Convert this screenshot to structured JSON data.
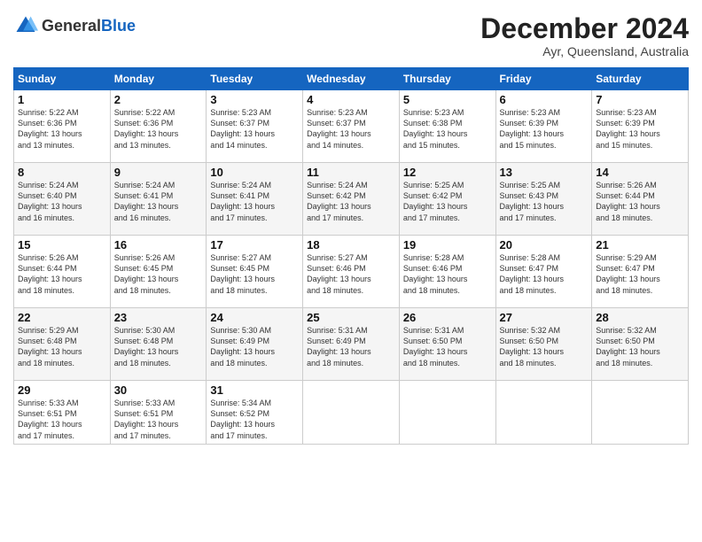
{
  "header": {
    "logo_general": "General",
    "logo_blue": "Blue",
    "month_title": "December 2024",
    "subtitle": "Ayr, Queensland, Australia"
  },
  "days_of_week": [
    "Sunday",
    "Monday",
    "Tuesday",
    "Wednesday",
    "Thursday",
    "Friday",
    "Saturday"
  ],
  "weeks": [
    [
      {
        "day": "1",
        "sunrise": "5:22 AM",
        "sunset": "6:36 PM",
        "daylight": "13 hours and 13 minutes."
      },
      {
        "day": "2",
        "sunrise": "5:22 AM",
        "sunset": "6:36 PM",
        "daylight": "13 hours and 13 minutes."
      },
      {
        "day": "3",
        "sunrise": "5:23 AM",
        "sunset": "6:37 PM",
        "daylight": "13 hours and 14 minutes."
      },
      {
        "day": "4",
        "sunrise": "5:23 AM",
        "sunset": "6:37 PM",
        "daylight": "13 hours and 14 minutes."
      },
      {
        "day": "5",
        "sunrise": "5:23 AM",
        "sunset": "6:38 PM",
        "daylight": "13 hours and 15 minutes."
      },
      {
        "day": "6",
        "sunrise": "5:23 AM",
        "sunset": "6:39 PM",
        "daylight": "13 hours and 15 minutes."
      },
      {
        "day": "7",
        "sunrise": "5:23 AM",
        "sunset": "6:39 PM",
        "daylight": "13 hours and 15 minutes."
      }
    ],
    [
      {
        "day": "8",
        "sunrise": "5:24 AM",
        "sunset": "6:40 PM",
        "daylight": "13 hours and 16 minutes."
      },
      {
        "day": "9",
        "sunrise": "5:24 AM",
        "sunset": "6:41 PM",
        "daylight": "13 hours and 16 minutes."
      },
      {
        "day": "10",
        "sunrise": "5:24 AM",
        "sunset": "6:41 PM",
        "daylight": "13 hours and 17 minutes."
      },
      {
        "day": "11",
        "sunrise": "5:24 AM",
        "sunset": "6:42 PM",
        "daylight": "13 hours and 17 minutes."
      },
      {
        "day": "12",
        "sunrise": "5:25 AM",
        "sunset": "6:42 PM",
        "daylight": "13 hours and 17 minutes."
      },
      {
        "day": "13",
        "sunrise": "5:25 AM",
        "sunset": "6:43 PM",
        "daylight": "13 hours and 17 minutes."
      },
      {
        "day": "14",
        "sunrise": "5:26 AM",
        "sunset": "6:44 PM",
        "daylight": "13 hours and 18 minutes."
      }
    ],
    [
      {
        "day": "15",
        "sunrise": "5:26 AM",
        "sunset": "6:44 PM",
        "daylight": "13 hours and 18 minutes."
      },
      {
        "day": "16",
        "sunrise": "5:26 AM",
        "sunset": "6:45 PM",
        "daylight": "13 hours and 18 minutes."
      },
      {
        "day": "17",
        "sunrise": "5:27 AM",
        "sunset": "6:45 PM",
        "daylight": "13 hours and 18 minutes."
      },
      {
        "day": "18",
        "sunrise": "5:27 AM",
        "sunset": "6:46 PM",
        "daylight": "13 hours and 18 minutes."
      },
      {
        "day": "19",
        "sunrise": "5:28 AM",
        "sunset": "6:46 PM",
        "daylight": "13 hours and 18 minutes."
      },
      {
        "day": "20",
        "sunrise": "5:28 AM",
        "sunset": "6:47 PM",
        "daylight": "13 hours and 18 minutes."
      },
      {
        "day": "21",
        "sunrise": "5:29 AM",
        "sunset": "6:47 PM",
        "daylight": "13 hours and 18 minutes."
      }
    ],
    [
      {
        "day": "22",
        "sunrise": "5:29 AM",
        "sunset": "6:48 PM",
        "daylight": "13 hours and 18 minutes."
      },
      {
        "day": "23",
        "sunrise": "5:30 AM",
        "sunset": "6:48 PM",
        "daylight": "13 hours and 18 minutes."
      },
      {
        "day": "24",
        "sunrise": "5:30 AM",
        "sunset": "6:49 PM",
        "daylight": "13 hours and 18 minutes."
      },
      {
        "day": "25",
        "sunrise": "5:31 AM",
        "sunset": "6:49 PM",
        "daylight": "13 hours and 18 minutes."
      },
      {
        "day": "26",
        "sunrise": "5:31 AM",
        "sunset": "6:50 PM",
        "daylight": "13 hours and 18 minutes."
      },
      {
        "day": "27",
        "sunrise": "5:32 AM",
        "sunset": "6:50 PM",
        "daylight": "13 hours and 18 minutes."
      },
      {
        "day": "28",
        "sunrise": "5:32 AM",
        "sunset": "6:50 PM",
        "daylight": "13 hours and 18 minutes."
      }
    ],
    [
      {
        "day": "29",
        "sunrise": "5:33 AM",
        "sunset": "6:51 PM",
        "daylight": "13 hours and 17 minutes."
      },
      {
        "day": "30",
        "sunrise": "5:33 AM",
        "sunset": "6:51 PM",
        "daylight": "13 hours and 17 minutes."
      },
      {
        "day": "31",
        "sunrise": "5:34 AM",
        "sunset": "6:52 PM",
        "daylight": "13 hours and 17 minutes."
      },
      null,
      null,
      null,
      null
    ]
  ]
}
